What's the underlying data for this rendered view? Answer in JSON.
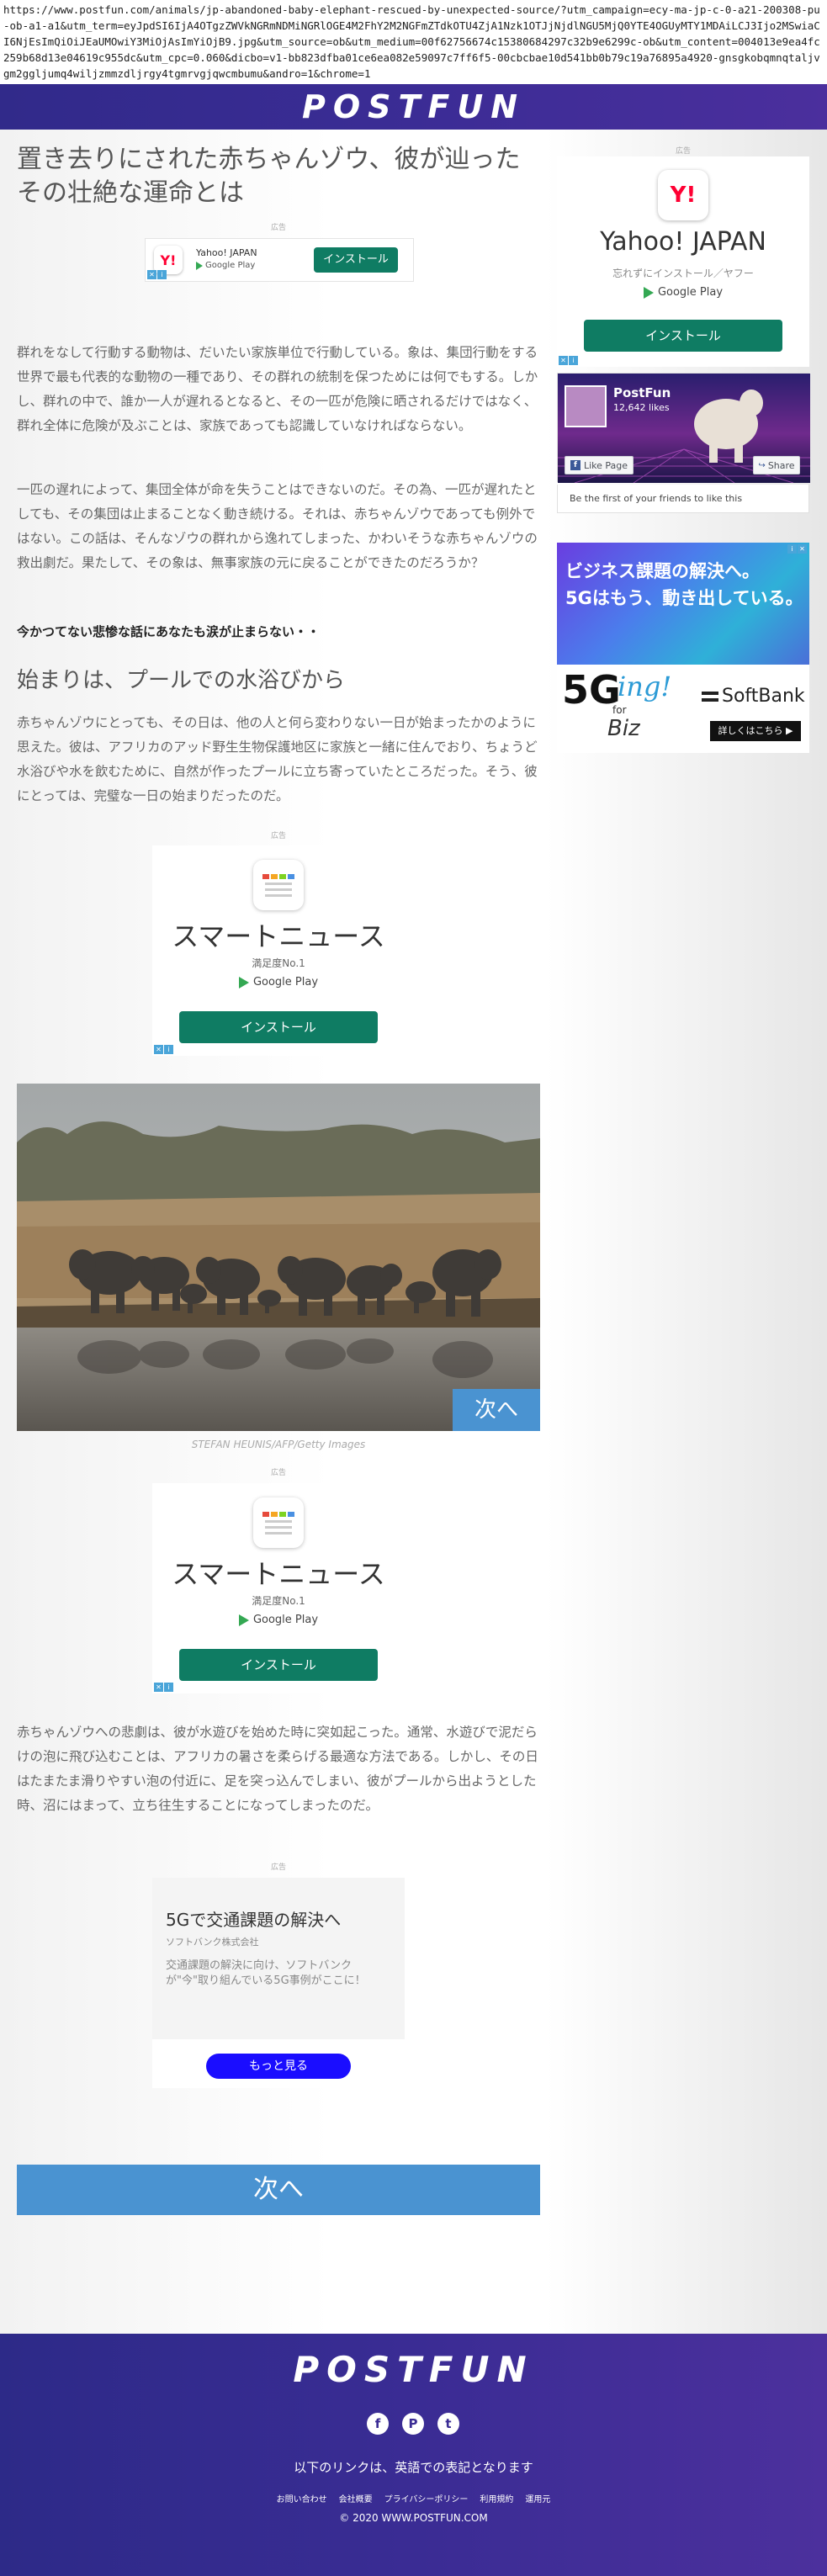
{
  "browser": {
    "url": "https://www.postfun.com/animals/jp-abandoned-baby-elephant-rescued-by-unexpected-source/?utm_campaign=ecy-ma-jp-c-0-a21-200308-pu-ob-a1-a1&utm_term=eyJpdSI6IjA4OTgzZWVkNGRmNDMiNGRlOGE4M2FhY2M2NGFmZTdkOTU4ZjA1Nzk1OTJjNjdlNGU5MjQ0YTE4OGUyMTY1MDAiLCJ3Ijo2MSwiaCI6NjEsImQiOiJEaUMOwiY3MiOjAsImYiOjB9.jpg&utm_source=ob&utm_medium=00f62756674c15380684297c32b9e6299c-ob&utm_content=004013e9ea4fc259b68d13e04619c955dc&utm_cpc=0.060&dicbo=v1-bb823dfba01ce6ea082e59097c7ff6f5-00cbcbae10d541bb0b79c19a76895a4920-gnsgkobqmnqtaljvgm2ggljumq4wiljzmmzdljrgy4tgmrvgjqwcmbumu&andro=1&chrome=1"
  },
  "header": {
    "logo": "POSTFUN"
  },
  "article": {
    "title": "置き去りにされた赤ちゃんゾウ、彼が辿ったその壮絶な運命とは",
    "ad_label": "広告",
    "para1": "群れをなして行動する動物は、だいたい家族単位で行動している。象は、集団行動をする世界で最も代表的な動物の一種であり、その群れの統制を保つためには何でもする。しかし、群れの中で、誰か一人が遅れるとなると、その一匹が危険に晒されるだけではなく、群れ全体に危険が及ぶことは、家族であっても認識していなければならない。",
    "para2": "一匹の遅れによって、集団全体が命を失うことはできないのだ。その為、一匹が遅れたとしても、その集団は止まることなく動き続ける。それは、赤ちゃんゾウであっても例外ではない。この話は、そんなゾウの群れから逸れてしまった、かわいそうな赤ちゃんゾウの救出劇だ。果たして、その象は、無事家族の元に戻ることができたのだろうか？",
    "lead": "今かつてない悲惨な話にあなたも涙が止まらない・・",
    "subhead": "始まりは、プールでの水浴びから",
    "para3": "赤ちゃんゾウにとっても、その日は、他の人と何ら変わりない一日が始まったかのように思えた。彼は、アフリカのアッド野生生物保護地区に家族と一緒に住んでおり、ちょうど水浴びや水を飲むために、自然が作ったプールに立ち寄っていたところだった。そう、彼にとっては、完璧な一日の始まりだったのだ。",
    "image_next": "次へ",
    "caption": "STEFAN HEUNIS/AFP/Getty Images",
    "para4": "赤ちゃんゾウへの悲劇は、彼が水遊びを始めた時に突如起こった。通常、水遊びで泥だらけの泡に飛び込むことは、アフリカの暑さを柔らげる最適な方法である。しかし、その日はたまたま滑りやすい泡の付近に、足を突っ込んでしまい、彼がプールから出ようとした時、沼にはまって、立ち往生することになってしまったのだ。",
    "next_button": "次へ"
  },
  "ads": {
    "yahoo_small": {
      "name": "Yahoo! JAPAN",
      "store": "Google Play",
      "button": "インストール"
    },
    "news1": {
      "name": "スマートニュース",
      "sub": "満足度No.1",
      "store": "Google Play",
      "button": "インストール"
    },
    "news2": {
      "name": "スマートニュース",
      "sub": "満足度No.1",
      "store": "Google Play",
      "button": "インストール"
    },
    "softbank_text": {
      "title": "5Gで交通課題の解決へ",
      "advertiser": "ソフトバンク株式会社",
      "body": "交通課題の解決に向け、ソフトバンクが\"今\"取り組んでいる5G事例がここに！",
      "button": "もっと見る"
    }
  },
  "sidebar": {
    "ad_label": "広告",
    "yahoo": {
      "icon": "Y!",
      "name": "Yahoo! JAPAN",
      "tagline": "忘れずにインストール／ヤフー",
      "store": "Google Play",
      "button": "インストール"
    },
    "facebook": {
      "page": "PostFun",
      "likes": "12,642 likes",
      "like_button": "Like Page",
      "share_button": "Share",
      "first_text": "Be the first of your friends to like this"
    },
    "softbank": {
      "line1": "ビジネス課題の解決へ。",
      "line2": "5Gはもう、動き出している。",
      "logo_5g": "5G",
      "ing": "ing!",
      "for": "for",
      "biz": "Biz",
      "brand": "SoftBank",
      "cta": "詳しくはこちら ▶"
    }
  },
  "footer": {
    "logo": "POSTFUN",
    "social": [
      "f",
      "P",
      "t"
    ],
    "note": "以下のリンクは、英語での表記となります",
    "links": [
      "お問い合わせ",
      "会社概要",
      "プライバシーポリシー",
      "利用規約",
      "運用元"
    ],
    "copyright": "© 2020 WWW.POSTFUN.COM"
  },
  "colors": {
    "header": "#3b2c95",
    "install_green": "#0f7c63",
    "next_blue": "#4a93d1"
  }
}
